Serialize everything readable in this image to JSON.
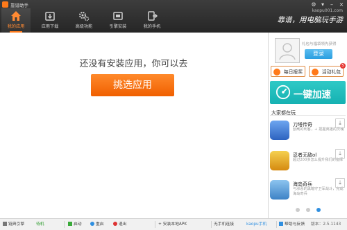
{
  "app": {
    "title": "靠谱助手"
  },
  "window_buttons": [
    "⚙",
    "▾",
    "–",
    "×"
  ],
  "nav": [
    {
      "label": "我的应用",
      "icon": "home-icon",
      "active": true
    },
    {
      "label": "应用下载",
      "icon": "download-box-icon"
    },
    {
      "label": "高级功能",
      "icon": "gears-icon"
    },
    {
      "label": "引擎安装",
      "icon": "engine-install-icon"
    },
    {
      "label": "我的手机",
      "icon": "phone-exit-icon"
    }
  ],
  "brand": {
    "url": "kaopu001.com",
    "slogan": "靠谱，用电脑玩手游"
  },
  "main": {
    "empty_message": "还没有安装应用，你可以去",
    "pick_button": "挑选应用"
  },
  "sidebar": {
    "login_hint": "礼包与福袋领先获得",
    "login_button": "登录",
    "daily_sign": "每日报奖",
    "activity_gift": "活动礼包",
    "activity_badge": "5",
    "accelerate": "一键加速",
    "section_title": "大家都在玩",
    "games": [
      {
        "name": "刀塔传奇",
        "desc": "刮刷的刺客，+ 把握英雄的灵魂",
        "icon_color": "#3b7bd4"
      },
      {
        "name": "忍者无敌ol",
        "desc": "超过200多怎么提升我们的指挥",
        "icon_color": "#e0b020"
      },
      {
        "name": "海岛奇兵",
        "desc": "与邪恶的黑暗守卫军战斗，完成海岛奇兵",
        "icon_color": "#5aa0d8"
      }
    ],
    "carousel": {
      "count": 3,
      "active": 3
    }
  },
  "status": {
    "engine_label": "链典引擎",
    "engine_status": "待机",
    "start": "启动",
    "restart": "重启",
    "exit": "退出",
    "install_apk": "+ 安装本地APK",
    "phone_status": "无手机连接",
    "phone_brand": "kaopu手机",
    "feedback": "帮助与反馈",
    "version": "版本：2.5.1143"
  },
  "colors": {
    "accent": "#ff7a1a",
    "teal": "#1fbcbc",
    "blue": "#2f8fe0",
    "header": "#2f2f2f"
  }
}
